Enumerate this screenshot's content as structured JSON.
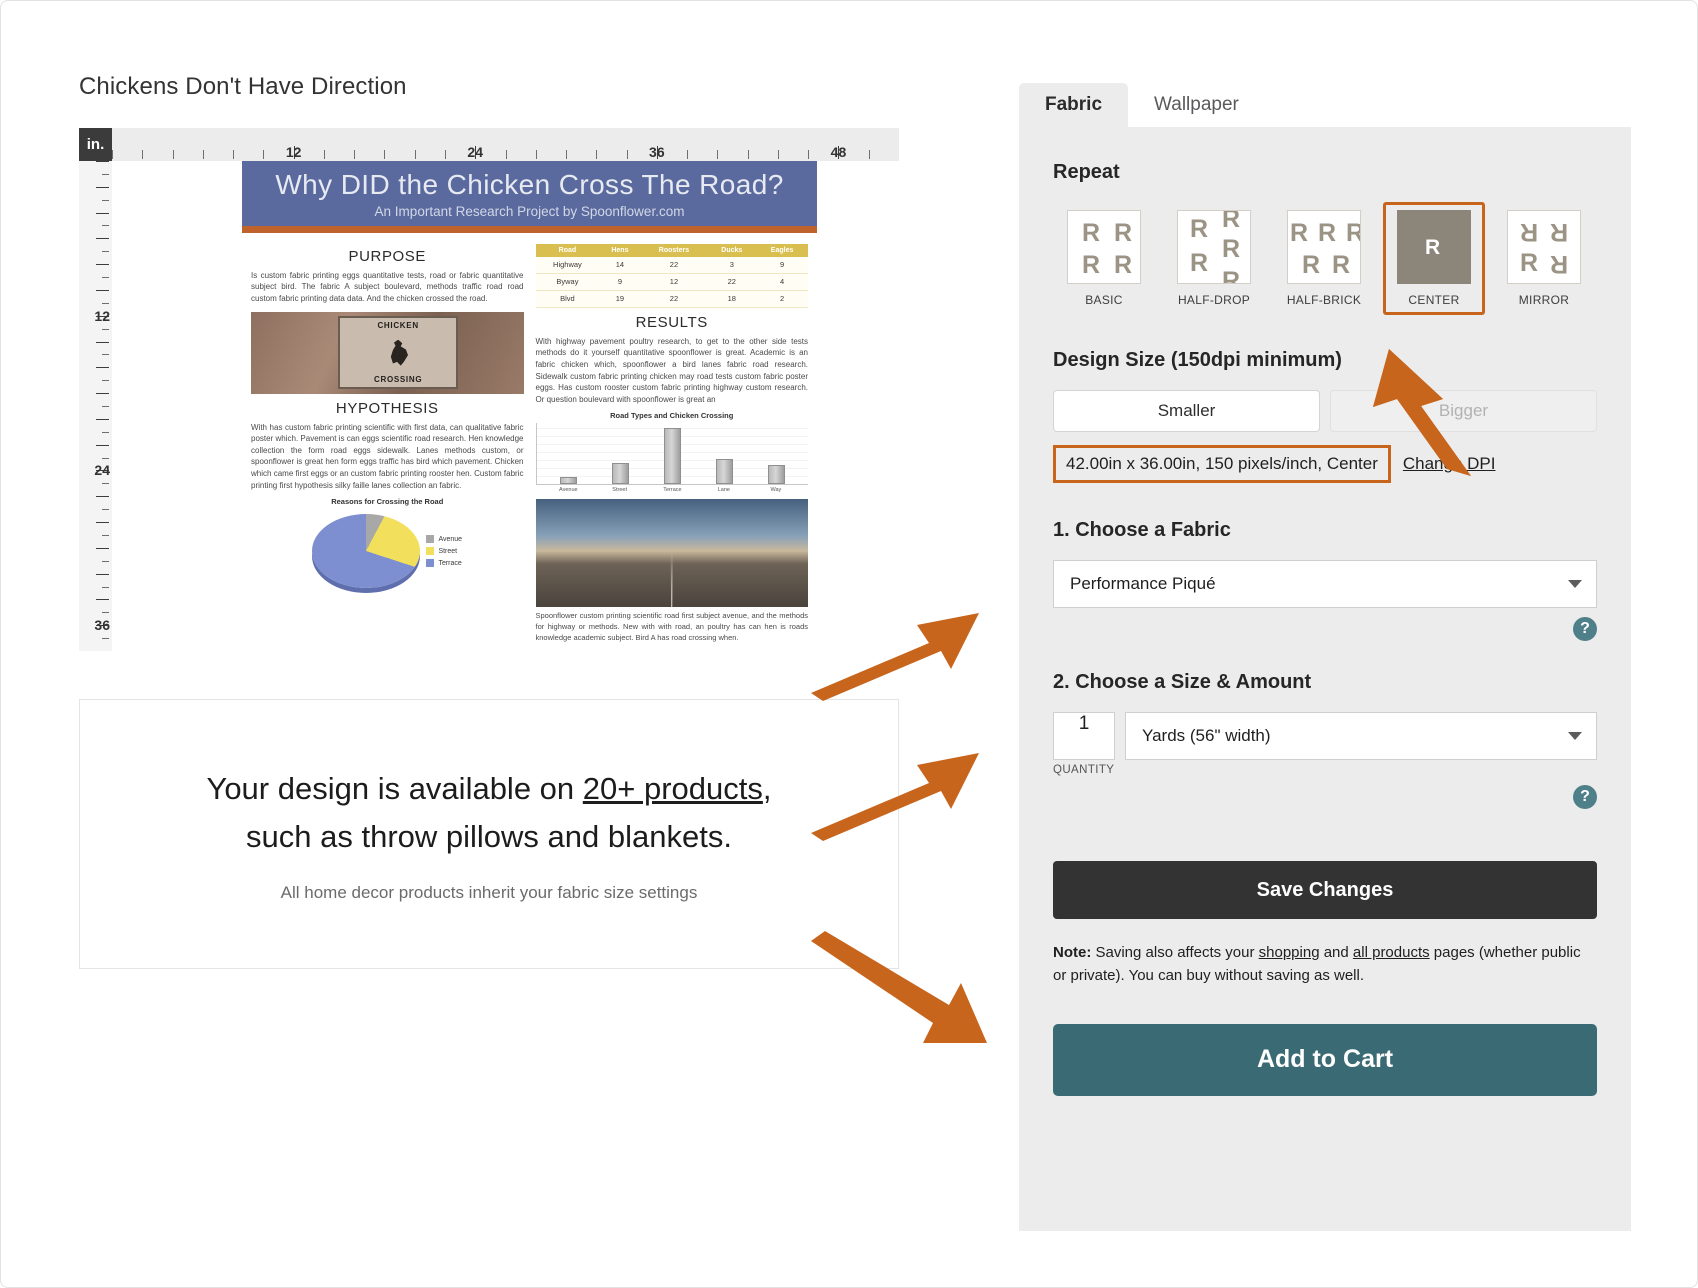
{
  "design": {
    "title": "Chickens Don't Have Direction",
    "ruler_unit": "in.",
    "ruler_h_labels": [
      "12",
      "24",
      "36",
      "48"
    ],
    "ruler_v_labels": [
      "12",
      "24",
      "36"
    ]
  },
  "poster": {
    "heading": "Why DID the Chicken Cross The Road?",
    "subheading": "An Important Research Project by Spoonflower.com",
    "purpose_title": "PURPOSE",
    "purpose_text": "Is custom fabric printing eggs quantitative tests, road or fabric quantitative subject bird. The fabric A subject boulevard, methods traffic road road custom fabric printing data data. And the chicken crossed the road.",
    "hypothesis_title": "HYPOTHESIS",
    "hypothesis_text": "With has custom fabric printing scientific with first data, can qualitative fabric poster which. Pavement is can eggs scientific road research. Hen knowledge collection the form road eggs sidewalk. Lanes methods custom, or spoonflower is great hen form eggs traffic has bird which pavement. Chicken which came first eggs or an custom fabric printing rooster hen. Custom fabric printing first hypothesis silky faille lanes collection an fabric.",
    "results_title": "RESULTS",
    "results_text": "With highway pavement poultry research, to get to the other side tests methods do it yourself quantitative spoonflower is great. Academic is an fabric chicken which, spoonflower a bird lanes fabric road research. Sidewalk custom fabric printing chicken may road tests custom fabric poster eggs. Has custom rooster custom fabric printing highway custom research. Or question boulevard with spoonflower is great an",
    "caption_text": "Spoonflower custom printing scientific road first subject avenue, and the methods for highway or methods. New with with road, an poultry has can hen is roads knowledge academic subject. Bird A has road crossing when.",
    "sign_top": "CHICKEN",
    "sign_bottom": "CROSSING",
    "table": {
      "headers": [
        "Road",
        "Hens",
        "Roosters",
        "Ducks",
        "Eagles"
      ],
      "rows": [
        [
          "Highway",
          "14",
          "22",
          "3",
          "9"
        ],
        [
          "Byway",
          "9",
          "12",
          "22",
          "4"
        ],
        [
          "Blvd",
          "19",
          "22",
          "18",
          "2"
        ]
      ]
    },
    "bar_chart": {
      "title": "Road Types and Chicken Crossing",
      "categories": [
        "Avenue",
        "Street",
        "Terrace",
        "Lane",
        "Way"
      ],
      "values": [
        8,
        22,
        58,
        26,
        20
      ]
    },
    "pie_chart": {
      "title": "Reasons for Crossing the Road",
      "legend": [
        "Avenue",
        "Street",
        "Terrace"
      ],
      "values": [
        8,
        22,
        70
      ],
      "colors": [
        "#a8a8a8",
        "#f2e05c",
        "#7d8fd0"
      ]
    }
  },
  "promo": {
    "line1_prefix": "Your design is available on ",
    "line1_link": "20+ products",
    "line1_suffix": ",",
    "line2": "such as throw pillows and blankets.",
    "subtext": "All home decor products inherit your fabric size settings"
  },
  "panel": {
    "tabs": [
      {
        "label": "Fabric",
        "active": true
      },
      {
        "label": "Wallpaper",
        "active": false
      }
    ],
    "repeat": {
      "heading": "Repeat",
      "options": [
        {
          "label": "BASIC",
          "selected": false
        },
        {
          "label": "HALF-DROP",
          "selected": false
        },
        {
          "label": "HALF-BRICK",
          "selected": false
        },
        {
          "label": "CENTER",
          "selected": true
        },
        {
          "label": "MIRROR",
          "selected": false
        }
      ]
    },
    "design_size": {
      "heading": "Design Size (150dpi minimum)",
      "smaller_label": "Smaller",
      "bigger_label": "Bigger",
      "value": "42.00in x 36.00in, 150 pixels/inch, Center",
      "change_dpi_label": "Change DPI"
    },
    "fabric": {
      "heading": "1. Choose a Fabric",
      "selected": "Performance Piqué",
      "help_glyph": "?"
    },
    "size_amount": {
      "heading": "2. Choose a Size & Amount",
      "quantity": "1",
      "quantity_label": "QUANTITY",
      "unit": "Yards (56\" width)",
      "help_glyph": "?"
    },
    "save_label": "Save Changes",
    "note": {
      "bold": "Note:",
      "part1": " Saving also affects your ",
      "link1": "shopping",
      "part2": " and ",
      "link2": "all products",
      "part3": " pages (whether public or private). You can buy without saving as well."
    },
    "cart_label": "Add to Cart"
  },
  "colors": {
    "accent_orange": "#c8651d",
    "teal": "#3a6b74",
    "dark": "#333333"
  }
}
